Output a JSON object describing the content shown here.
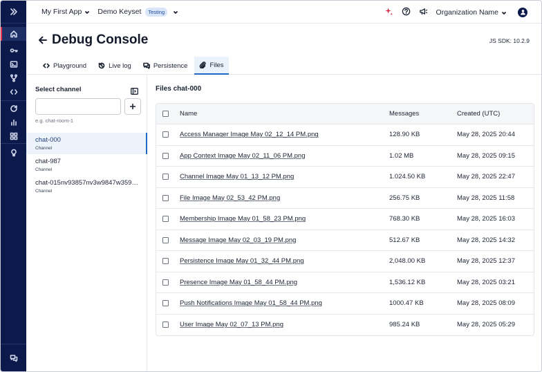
{
  "topbar": {
    "app_name": "My First App",
    "keyset_name": "Demo Keyset",
    "keyset_badge": "Testing",
    "org_name": "Organization Name"
  },
  "header": {
    "title": "Debug Console",
    "sdk_version": "JS SDK: 10.2.9"
  },
  "tabs": [
    {
      "label": "Playground",
      "icon": "code-icon"
    },
    {
      "label": "Live log",
      "icon": "history-icon"
    },
    {
      "label": "Persistence",
      "icon": "chat-icon"
    },
    {
      "label": "Files",
      "icon": "paperclip-icon",
      "active": true
    }
  ],
  "channels": {
    "header": "Select channel",
    "input_value": "",
    "hint": "e.g. chat-room-1",
    "items": [
      {
        "name": "chat-000",
        "type": "Channel",
        "active": true
      },
      {
        "name": "chat-987",
        "type": "Channel"
      },
      {
        "name": "chat-015nv93857nv3w9847w3597...",
        "type": "Channel"
      }
    ]
  },
  "files": {
    "title": "Files chat-000",
    "columns": {
      "name": "Name",
      "size": "Messages",
      "created": "Created (UTC)"
    },
    "rows": [
      {
        "name": "Access Manager Image May 02_12_14 PM.png",
        "size": "128.90 KB",
        "created": "May 28, 2025 20:44"
      },
      {
        "name": "App Context Image May 02_11_06 PM.png",
        "size": "1.02 MB",
        "created": "May 28, 2025 09:15"
      },
      {
        "name": "Channel Image May 01_13_12 PM.png",
        "size": "1.024.50 KB",
        "created": "May 28, 2025 22:47"
      },
      {
        "name": "File Image May 02_53_42 PM.png",
        "size": "256.75 KB",
        "created": "May 28, 2025 11:58"
      },
      {
        "name": "Membership Image May 01_58_23 PM.png",
        "size": "768.30 KB",
        "created": "May 28, 2025 16:03"
      },
      {
        "name": "Message Image May 02_03_19 PM.png",
        "size": "512.67 KB",
        "created": "May 28, 2025 14:32"
      },
      {
        "name": "Persistence Image May 01_32_44 PM.png",
        "size": "2,048.00 KB",
        "created": "May 28, 2025 12:37"
      },
      {
        "name": "Presence Image May 01_58_44 PM.png",
        "size": "1,536.12 KB",
        "created": "May 28, 2025 03:21"
      },
      {
        "name": "Push Notifications Image May 01_58_44 PM.png",
        "size": "1000.47 KB",
        "created": "May 28, 2025 08:09"
      },
      {
        "name": "User Image May 02_07_13 PM.png",
        "size": "985.24 KB",
        "created": "May 28, 2025 05:29"
      }
    ]
  },
  "colors": {
    "rail": "#0b1a4a",
    "accent": "#1f66c6",
    "rail_active_marker": "#e8324b"
  }
}
